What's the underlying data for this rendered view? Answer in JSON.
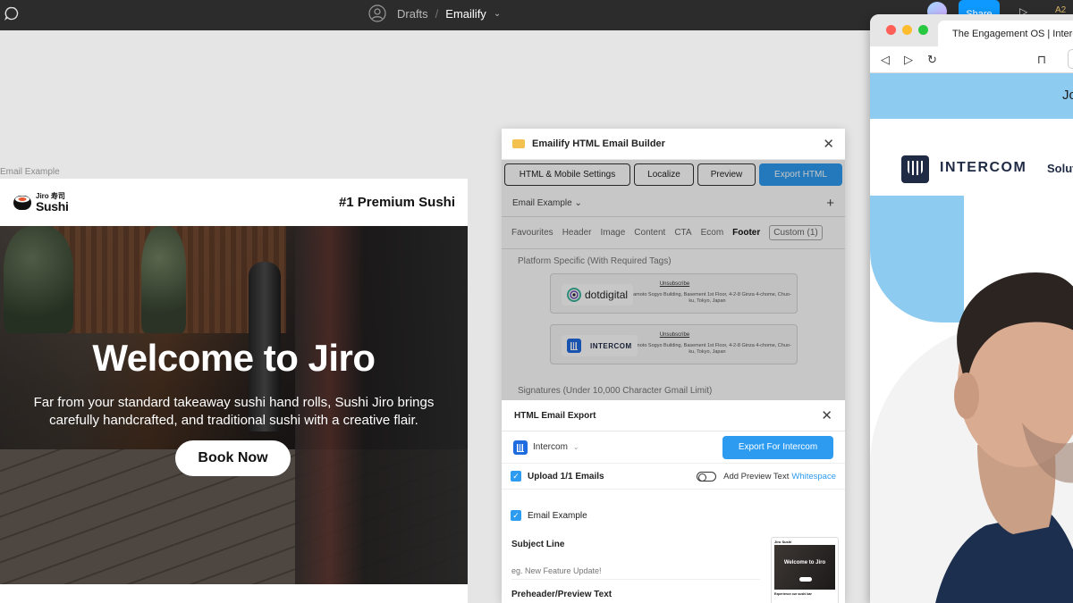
{
  "figma": {
    "breadcrumb": {
      "drafts": "Drafts",
      "separator": "/",
      "file": "Emailify"
    },
    "share_label": "Share",
    "zoom_label": "A2"
  },
  "canvas": {
    "frame_label": "Email Example",
    "email": {
      "logo_top": "Jiro 寿司",
      "logo_main": "Sushi",
      "tagline": "#1 Premium Sushi",
      "hero_title": "Welcome to Jiro",
      "hero_text": "Far from your standard takeaway sushi hand rolls, Sushi Jiro brings carefully handcrafted, and traditional sushi with a creative flair.",
      "cta": "Book Now"
    }
  },
  "plugin": {
    "title": "Emailify HTML Email Builder",
    "tabs": [
      "HTML & Mobile Settings",
      "Localize",
      "Preview",
      "Export HTML"
    ],
    "email_select": "Email Example",
    "add_symbol": "+",
    "categories": [
      "Favourites",
      "Header",
      "Image",
      "Content",
      "CTA",
      "Ecom",
      "Footer",
      "Custom (1)"
    ],
    "active_category": "Footer",
    "section_platform": "Platform Specific (With Required Tags)",
    "section_signatures": "Signatures (Under 10,000 Character Gmail Limit)",
    "footer_cards": [
      {
        "brand": "dotdigital",
        "unsubscribe": "Unsubscribe",
        "address": "Yamamoto Sogyo Building, Basement 1st Floor, 4-2-8 Ginza 4-chome, Chuo-ku, Tokyo, Japan"
      },
      {
        "brand": "INTERCOM",
        "unsubscribe": "Unsubscribe",
        "address": "Yamamoto Sogyo Building, Basement 1st Floor, 4-2-8 Ginza 4-chome, Chuo-ku, Tokyo, Japan"
      }
    ]
  },
  "export": {
    "title": "HTML Email Export",
    "provider": "Intercom",
    "export_button": "Export For Intercom",
    "upload_label": "Upload 1/1 Emails",
    "preview_text_label": "Add Preview Text",
    "whitespace_link": "Whitespace",
    "email_item": "Email Example",
    "subject_label": "Subject Line",
    "subject_placeholder": "eg. New Feature Update!",
    "preheader_label": "Preheader/Preview Text",
    "thumb_title": "Welcome to Jiro",
    "thumb_logo": "Jiro Sushi",
    "thumb_footer": "Experience our sushi bar"
  },
  "browser": {
    "tab_title": "The Engagement OS | Intercom",
    "banner_text": "Jo",
    "logo_text": "INTERCOM",
    "menu_text": "Solut"
  },
  "colors": {
    "figma_bar": "#2c2c2c",
    "accent_blue": "#2d9bf0",
    "intercom_navy": "#1f2a44",
    "intercom_sky": "#8ecbf0"
  }
}
